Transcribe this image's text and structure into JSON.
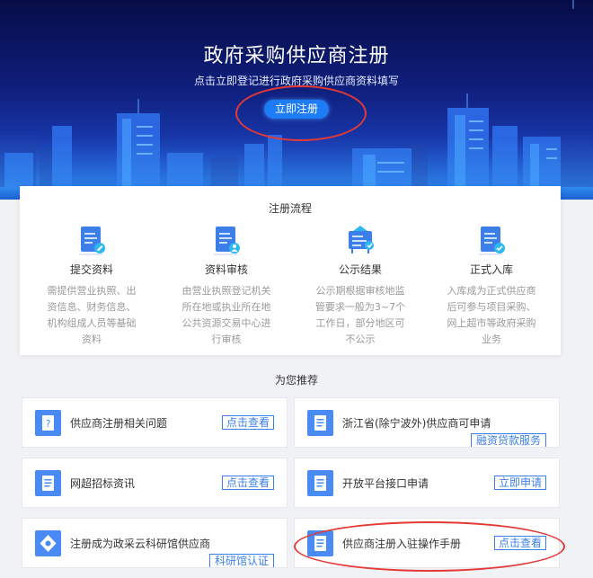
{
  "banner": {
    "title": "政府采购供应商注册",
    "subtitle": "点击立即登记进行政府采购供应商资料填写",
    "register_button": "立即注册"
  },
  "process": {
    "title": "注册流程",
    "steps": [
      {
        "name": "提交资料",
        "desc": "需提供营业执照、出资信息、财务信息、机构组成人员等基础资料",
        "icon": "document-edit-icon"
      },
      {
        "name": "资料审核",
        "desc": "由营业执照登记机关所在地或执业所在地公共资源交易中心进行审核",
        "icon": "document-user-icon"
      },
      {
        "name": "公示结果",
        "desc": "公示期根据审核地监管要求一般为3~7个工作日，部分地区可不公示",
        "icon": "announcement-board-icon"
      },
      {
        "name": "正式入库",
        "desc": "入库成为正式供应商后可参与项目采购、网上超市等政府采购业务",
        "icon": "document-check-icon"
      }
    ]
  },
  "recommend": {
    "title": "为您推荐",
    "items": [
      {
        "label": "供应商注册相关问题",
        "button": "点击查看",
        "icon": "question-icon",
        "tag": ""
      },
      {
        "label": "浙江省(除宁波外)供应商可申请",
        "button": "",
        "icon": "document-icon",
        "tag": "融资贷款服务"
      },
      {
        "label": "网超招标资讯",
        "button": "点击查看",
        "icon": "document-icon",
        "tag": ""
      },
      {
        "label": "开放平台接口申请",
        "button": "立即申请",
        "icon": "document-icon",
        "tag": ""
      },
      {
        "label": "注册成为政采云科研馆供应商",
        "button": "",
        "icon": "diamond-icon",
        "tag": "科研馆认证"
      },
      {
        "label": "供应商注册入驻操作手册",
        "button": "点击查看",
        "icon": "document-icon",
        "tag": ""
      }
    ]
  },
  "colors": {
    "accent": "#1e7cf7",
    "link_blue": "#3d7fe8",
    "highlight_circle": "#e53935",
    "banner_dark": "#070c46"
  }
}
